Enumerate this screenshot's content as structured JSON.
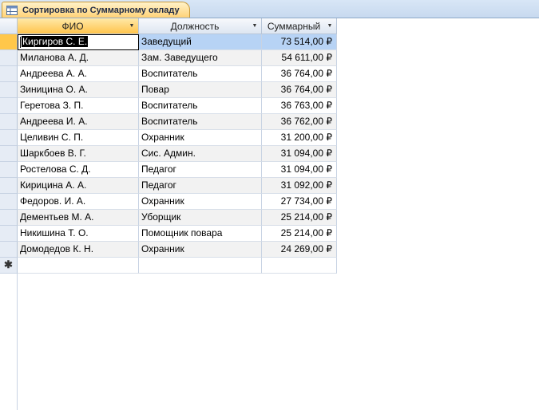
{
  "tab": {
    "title": "Сортировка по Суммарному окладу",
    "icon": "query-datasheet-icon"
  },
  "columns": [
    {
      "label": "ФИО"
    },
    {
      "label": "Должность"
    },
    {
      "label": "Суммарный"
    }
  ],
  "rows": [
    {
      "name": "Киргиров С. Е.",
      "position": "Заведущий",
      "sum": "73 514,00 ₽"
    },
    {
      "name": "Миланова А. Д.",
      "position": "Зам. Заведущего",
      "sum": "54 611,00 ₽"
    },
    {
      "name": "Андреева А. А.",
      "position": "Воспитатель",
      "sum": "36 764,00 ₽"
    },
    {
      "name": "Зиницина О. А.",
      "position": "Повар",
      "sum": "36 764,00 ₽"
    },
    {
      "name": "Геретова З. П.",
      "position": "Воспитатель",
      "sum": "36 763,00 ₽"
    },
    {
      "name": "Андреева И. А.",
      "position": "Воспитатель",
      "sum": "36 762,00 ₽"
    },
    {
      "name": "Целивин С. П.",
      "position": "Охранник",
      "sum": "31 200,00 ₽"
    },
    {
      "name": "Шаркбоев В. Г.",
      "position": "Сис. Админ.",
      "sum": "31 094,00 ₽"
    },
    {
      "name": "Ростелова С. Д.",
      "position": "Педагог",
      "sum": "31 094,00 ₽"
    },
    {
      "name": "Кирицина А. А.",
      "position": "Педагог",
      "sum": "31 092,00 ₽"
    },
    {
      "name": "Федоров. И. А.",
      "position": "Охранник",
      "sum": "27 734,00 ₽"
    },
    {
      "name": "Дементьев М. А.",
      "position": "Уборщик",
      "sum": "25 214,00 ₽"
    },
    {
      "name": "Никишина Т. О.",
      "position": "Помощник повара",
      "sum": "25 214,00 ₽"
    },
    {
      "name": "Домодедов К. Н.",
      "position": "Охранник",
      "sum": "24 269,00 ₽"
    }
  ],
  "new_record_symbol": "✱"
}
